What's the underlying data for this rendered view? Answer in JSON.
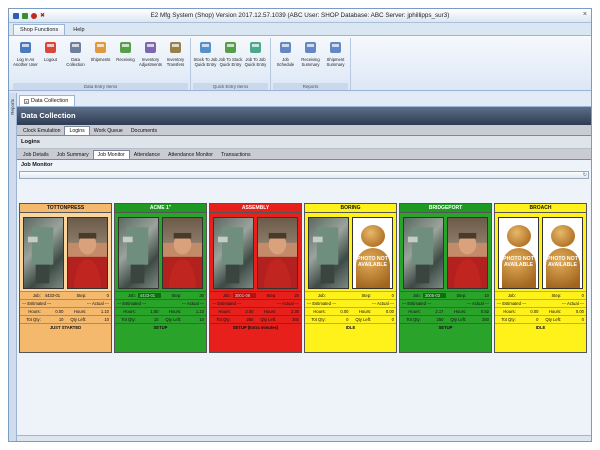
{
  "window": {
    "title": "E2 Mfg System (Shop) Version 2017.12.57.1039 (ABC User: SHOP Database: ABC Server: jphillipps_sur3)",
    "close_glyph": "×"
  },
  "qat_colors": [
    "#2b5fb3",
    "#c02a1e",
    "#3a8f2c",
    "#b0211a"
  ],
  "ribbon": {
    "tabs": [
      {
        "label": "Shop Functions",
        "active": true
      },
      {
        "label": "Help",
        "active": false
      }
    ],
    "groups": [
      {
        "name": "Data Entry Items",
        "buttons": [
          {
            "label": "Log In As Another User",
            "icon": "user-login-icon"
          },
          {
            "label": "Logout",
            "icon": "logout-icon"
          },
          {
            "label": "Data Collection",
            "icon": "clock-icon"
          },
          {
            "label": "Shipments",
            "icon": "shipments-icon"
          },
          {
            "label": "Receiving",
            "icon": "receiving-icon"
          },
          {
            "label": "Inventory Adjustments",
            "icon": "inventory-adjust-icon"
          },
          {
            "label": "Inventory Transfers",
            "icon": "inventory-transfer-icon"
          }
        ]
      },
      {
        "name": "Quick Entry Items",
        "buttons": [
          {
            "label": "Stock To Job Quick Entry",
            "icon": "stock-to-job-icon"
          },
          {
            "label": "Job To Stock Quick Entry",
            "icon": "job-to-stock-icon"
          },
          {
            "label": "Job To Job Quick Entry",
            "icon": "job-to-job-icon"
          }
        ]
      },
      {
        "name": "Reports",
        "buttons": [
          {
            "label": "Job Schedule",
            "icon": "job-schedule-icon"
          },
          {
            "label": "Receiving Summary",
            "icon": "receiving-summary-icon"
          },
          {
            "label": "Shipment Summary",
            "icon": "shipment-summary-icon"
          }
        ]
      }
    ]
  },
  "sidebar": {
    "label": "Reports"
  },
  "doc_tab": {
    "label": "Data Collection",
    "close_glyph": "x"
  },
  "panel": {
    "title": "Data Collection",
    "tabs": [
      "Clock Emulation",
      "Logins",
      "Work Queue",
      "Documents"
    ],
    "active_tab": 1,
    "section_title": "Logins",
    "subtabs": [
      "Job Details",
      "Job Summary",
      "Job Monitor",
      "Attendance",
      "Attendance Monitor",
      "Transactions"
    ],
    "active_subtab": 2,
    "monitor_title": "Job Monitor",
    "refresh_glyph": "↻"
  },
  "labels": {
    "job": "Job:",
    "step": "Step:",
    "estimated": "--- Estimated ---",
    "actual": "--- Actual ---",
    "hours": "Hours:",
    "tot_qty": "Tot Qty:",
    "qty_left": "Qty Left:",
    "photo_na": "PHOTO NOT AVAILABLE"
  },
  "cards": [
    {
      "name": "TOTTONPRESS",
      "color": "orange",
      "job": "4433-01",
      "step": "0",
      "est_hours": "0.00",
      "act_hours": "1.10",
      "tot_qty": "10",
      "qty_left": "10",
      "status": "JUST STARTED",
      "photos": [
        "machine",
        "person"
      ]
    },
    {
      "name": "ACME 1\"",
      "color": "green",
      "job": "4433-01",
      "step": "30",
      "est_hours": "1.50",
      "act_hours": "1.23",
      "tot_qty": "10",
      "qty_left": "10",
      "status": "SETUP",
      "photos": [
        "machine",
        "person"
      ]
    },
    {
      "name": "ASSEMBLY",
      "color": "red",
      "job": "3001-06",
      "step": "20",
      "est_hours": "2.00",
      "act_hours": "2.30",
      "tot_qty": "250",
      "qty_left": "250",
      "status": "SETUP (Extra minutes)",
      "photos": [
        "machine",
        "person"
      ]
    },
    {
      "name": "BORING",
      "color": "yellow",
      "job": "",
      "step": "0",
      "est_hours": "0.00",
      "act_hours": "0.00",
      "tot_qty": "0",
      "qty_left": "0",
      "status": "IDLE",
      "photos": [
        "machine",
        "na"
      ]
    },
    {
      "name": "BRIDGEPORT",
      "color": "green",
      "job": "3005-03",
      "step": "10",
      "est_hours": "2.17",
      "act_hours": "0.52",
      "tot_qty": "250",
      "qty_left": "250",
      "status": "SETUP",
      "photos": [
        "machine",
        "person"
      ]
    },
    {
      "name": "BROACH",
      "color": "yellow",
      "job": "",
      "step": "0",
      "est_hours": "0.00",
      "act_hours": "0.00",
      "tot_qty": "0",
      "qty_left": "0",
      "status": "IDLE",
      "photos": [
        "na",
        "na"
      ]
    }
  ]
}
